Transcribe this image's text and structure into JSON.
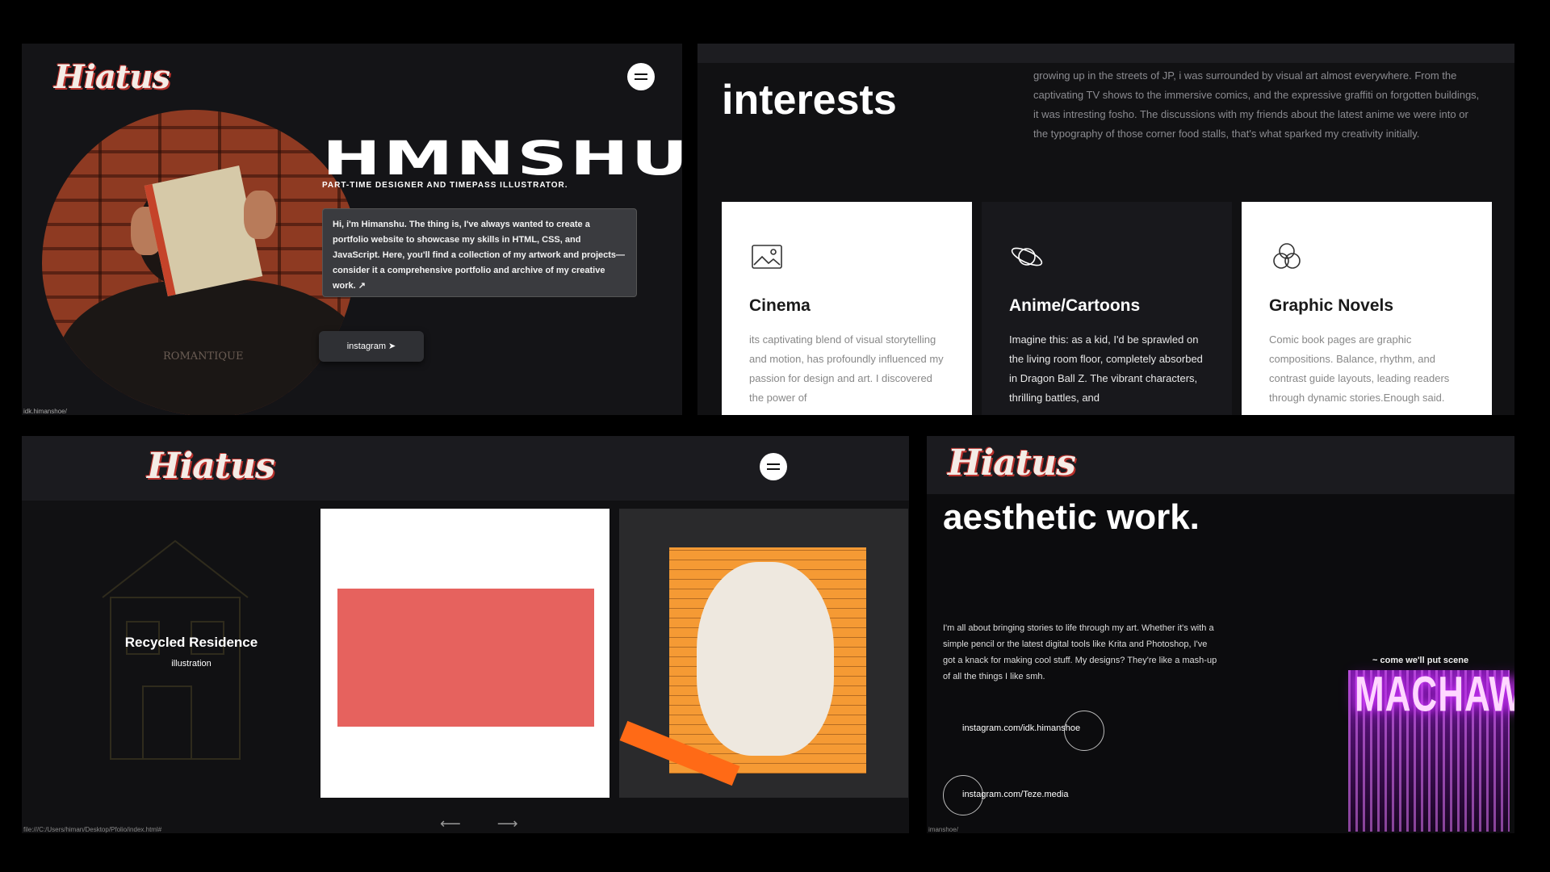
{
  "hero": {
    "logo": "Hiatus",
    "title": "HMNSHU",
    "subtitle": "PART-TIME DESIGNER AND TIMEPASS ILLUSTRATOR.",
    "bio": "Hi, i'm Himanshu. The thing is, I've always wanted to create a portfolio website to showcase my skills in HTML, CSS, and JavaScript. Here, you'll find a collection of my artwork and projects—consider it a comprehensive portfolio and archive of my creative work. ↗",
    "instagram_button": "instagram ➤",
    "shirt_text": "ROMANTIQUE",
    "url": "idk.himanshoe/"
  },
  "interests": {
    "title": "interests",
    "paragraph": "growing up in the streets of JP, i was surrounded by visual art almost everywhere. From the captivating TV shows to the immersive comics, and the expressive graffiti on forgotten buildings, it was intresting fosho. The discussions with my friends about the latest anime we were into or the typography of those corner food stalls, that's what sparked my creativity initially.",
    "cards": [
      {
        "icon": "image-icon",
        "title": "Cinema",
        "text": "its captivating blend of visual storytelling and motion, has profoundly influenced my passion for design and art. I discovered the power of"
      },
      {
        "icon": "planet-icon",
        "title": "Anime/Cartoons",
        "text": "Imagine this: as a kid, I'd be sprawled on the living room floor, completely absorbed in Dragon Ball Z. The vibrant characters, thrilling battles, and"
      },
      {
        "icon": "circles-icon",
        "title": "Graphic Novels",
        "text": "Comic book pages are graphic compositions. Balance, rhythm, and contrast guide layouts, leading readers through dynamic stories.Enough said."
      }
    ]
  },
  "gallery": {
    "logo": "Hiatus",
    "item_title": "Recycled Residence",
    "item_sub": "illustration",
    "arrows": "⟵ ⟶",
    "url": "file:///C:/Users/himan/Desktop/Pfolio/index.html#"
  },
  "aesthetic": {
    "logo": "Hiatus",
    "title": "aesthetic work.",
    "paragraph": "I'm all about bringing stories to life through my art. Whether it's with a simple pencil or the latest digital tools like Krita and Photoshop, I've got a knack for making cool stuff. My designs? They're like a mash-up of all the things I like smh.",
    "link1": "instagram.com/idk.himanshoe",
    "link2": "instagram.com/Teze.media",
    "machaww_caption": "~ come we'll put scene",
    "machaww": "MACHAWW",
    "url": "imanshoe/"
  }
}
